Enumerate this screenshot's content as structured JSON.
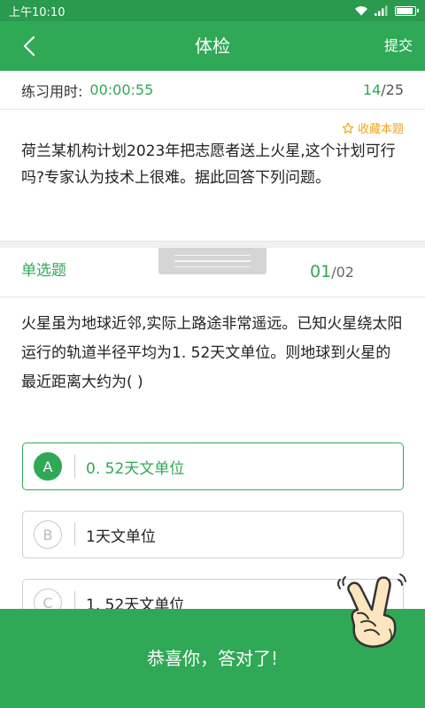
{
  "status_bar": {
    "time": "上午10:10",
    "icons": [
      "wifi-icon",
      "signal-icon",
      "battery-icon"
    ]
  },
  "app_bar": {
    "back_icon": "chevron-left-icon",
    "title": "体检",
    "submit_label": "提交"
  },
  "timer": {
    "label": "练习用时:",
    "elapsed": "00:00:55",
    "current": "14",
    "total": "/25"
  },
  "favorite": {
    "icon": "star-outline-icon",
    "label": "收藏本题"
  },
  "passage": "荷兰某机构计划2023年把志愿者送上火星,这个计划可行吗?专家认为技术上很难。据此回答下列问题。",
  "question_header": {
    "type": "单选题",
    "current": "01",
    "total": "/02"
  },
  "question": "火星虽为地球近邻,实际上路途非常遥远。已知火星绕太阳运行的轨道半径平均为1. 52天文单位。则地球到火星的最近距离大约为(    )",
  "options": [
    {
      "letter": "A",
      "text": "0. 52天文单位",
      "selected": true
    },
    {
      "letter": "B",
      "text": "1天文单位",
      "selected": false
    },
    {
      "letter": "C",
      "text": "1. 52天文单位",
      "selected": false
    }
  ],
  "result": {
    "message": "恭喜你，答对了!",
    "icon": "victory-hand-icon"
  },
  "colors": {
    "primary": "#2fa956",
    "status_bar": "#2a9a4e",
    "favorite": "#f4a31c"
  }
}
